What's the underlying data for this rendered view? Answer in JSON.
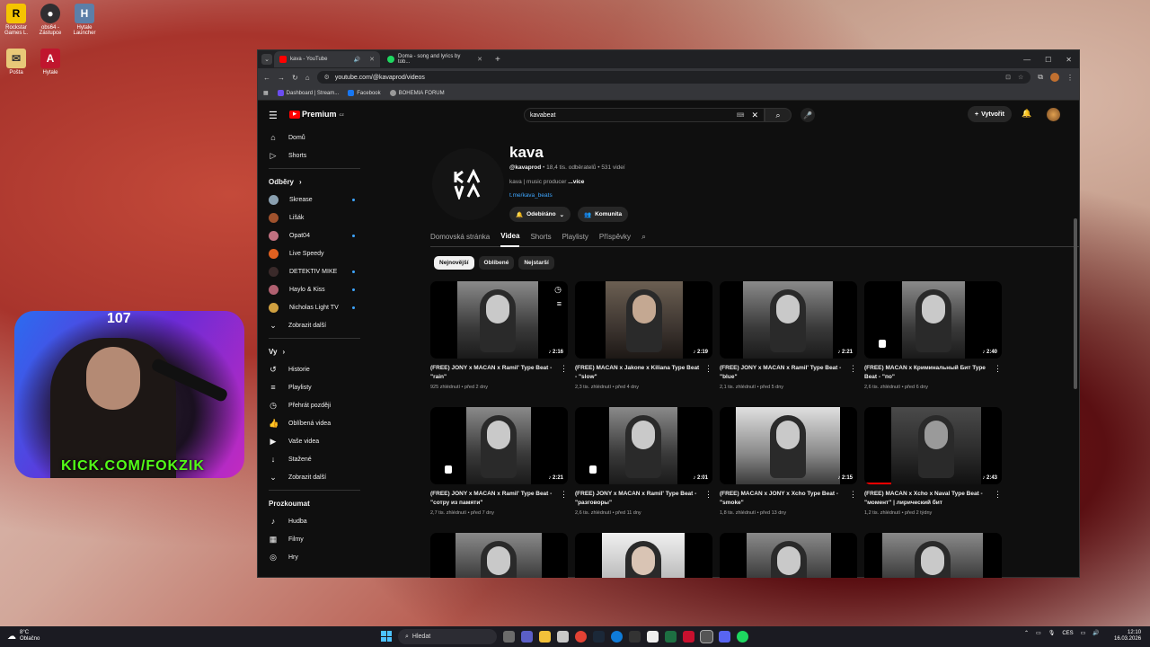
{
  "desktop": {
    "icons": [
      {
        "label": "Rockstar Games L.",
        "glyph": "R",
        "color": "#f5c400",
        "text": "#000"
      },
      {
        "label": "obs64 - Zástupce",
        "glyph": "●",
        "color": "#302e31",
        "text": "#fff"
      },
      {
        "label": "Hytale Launcher",
        "glyph": "H",
        "color": "#5c7fa8",
        "text": "#fff"
      },
      {
        "label": "Pošta",
        "glyph": "✉",
        "color": "#e8c878",
        "text": "#333"
      },
      {
        "label": "Hytale",
        "glyph": "A",
        "color": "#c0162e",
        "text": "#fff"
      }
    ]
  },
  "webcam": {
    "counter": "107",
    "overlay": "KICK.COM/FOKZIK"
  },
  "browser": {
    "tabs": [
      {
        "title": "kava - YouTube",
        "fav_color": "#ff0000",
        "active": true
      },
      {
        "title": "Doma - song and lyrics by tob...",
        "fav_color": "#1ed760",
        "active": false
      }
    ],
    "url": "youtube.com/@kavaprod/videos",
    "bookmarks": [
      {
        "label": "Dashboard | Stream...",
        "color": "#6b4df0"
      },
      {
        "label": "Facebook",
        "color": "#1877f2"
      },
      {
        "label": "BOHEMIA FORUM",
        "color": "#999999"
      }
    ]
  },
  "youtube": {
    "logo_text": "Premium",
    "logo_region": "CZ",
    "search_value": "kavabeat",
    "create_label": "Vytvořit",
    "sidebar": {
      "main": [
        {
          "label": "Domů",
          "icon": "⌂"
        },
        {
          "label": "Shorts",
          "icon": "▷"
        }
      ],
      "subs_heading": "Odběry",
      "subs": [
        {
          "label": "Skrease",
          "color": "#8aa0b0",
          "dot": true
        },
        {
          "label": "Lišák",
          "color": "#a0522d",
          "dot": false
        },
        {
          "label": "Opat04",
          "color": "#c07080",
          "dot": true
        },
        {
          "label": "Live Speedy",
          "color": "#e06020",
          "dot": false
        },
        {
          "label": "DETEKTIV MIKE",
          "color": "#3a2a2a",
          "dot": true
        },
        {
          "label": "Haylo & Kiss",
          "color": "#b06070",
          "dot": true
        },
        {
          "label": "Nicholas Light TV",
          "color": "#d0a040",
          "dot": true
        }
      ],
      "subs_more": "Zobrazit další",
      "you_heading": "Vy",
      "you": [
        {
          "label": "Historie",
          "icon": "↺"
        },
        {
          "label": "Playlisty",
          "icon": "≡"
        },
        {
          "label": "Přehrát později",
          "icon": "◷"
        },
        {
          "label": "Oblíbená videa",
          "icon": "👍"
        },
        {
          "label": "Vaše videa",
          "icon": "▶"
        },
        {
          "label": "Stažené",
          "icon": "↓"
        }
      ],
      "you_more": "Zobrazit další",
      "explore_heading": "Prozkoumat",
      "explore": [
        {
          "label": "Hudba",
          "icon": "♪"
        },
        {
          "label": "Filmy",
          "icon": "▦"
        },
        {
          "label": "Hry",
          "icon": "◎"
        }
      ]
    },
    "channel": {
      "name": "kava",
      "handle": "@kavaprod",
      "stats": " • 18,4 tis. odběratelů • 531 videí",
      "description": "kava | music producer ",
      "more": "...více",
      "link": "t.me/kava_beats",
      "subscribed_label": "Odebíráno",
      "community_label": "Komunita",
      "tabs": [
        "Domovská stránka",
        "Videa",
        "Shorts",
        "Playlisty",
        "Příspěvky"
      ],
      "active_tab": 1,
      "chips": [
        "Nejnovější",
        "Oblíbené",
        "Nejstarší"
      ],
      "active_chip": 0
    },
    "videos": [
      {
        "title": "(FREE) JONY x MACAN x Ramil' Type Beat - \"rain\"",
        "meta": "925 zhlédnutí • před 2 dny",
        "duration": "♪ 2:16"
      },
      {
        "title": "(FREE) MACAN x Jakone x Kiliana Type Beat - \"slow\"",
        "meta": "2,3 tis. zhlédnutí • před 4 dny",
        "duration": "♪ 2:19"
      },
      {
        "title": "(FREE) JONY x MACAN x Ramil' Type Beat - \"blue\"",
        "meta": "2,1 tis. zhlédnutí • před 5 dny",
        "duration": "♪ 2:21"
      },
      {
        "title": "(FREE) MACAN x Криминальный Бит Type Beat - \"по\"",
        "meta": "2,6 tis. zhlédnutí • před 6 dny",
        "duration": "♪ 2:40"
      },
      {
        "title": "(FREE) JONY x MACAN x Ramil' Type Beat - \"сотру из памяти\"",
        "meta": "2,7 tis. zhlédnutí • před 7 dny",
        "duration": "♪ 2:21"
      },
      {
        "title": "(FREE) JONY x MACAN x Ramil' Type Beat - \"разговоры\"",
        "meta": "2,6 tis. zhlédnutí • před 11 dny",
        "duration": "♪ 2:01"
      },
      {
        "title": "(FREE) MACAN x JONY x Xcho Type Beat - \"smoke\"",
        "meta": "1,8 tis. zhlédnutí • před 13 dny",
        "duration": "♪ 2:15"
      },
      {
        "title": "(FREE) MACAN x Xcho x Naval Type Beat - \"момент\" | лирический бит",
        "meta": "1,2 tis. zhlédnutí • před 2 týdny",
        "duration": "♪ 2:43"
      },
      {
        "title": "",
        "meta": "",
        "duration": ""
      },
      {
        "title": "",
        "meta": "",
        "duration": ""
      },
      {
        "title": "",
        "meta": "",
        "duration": ""
      },
      {
        "title": "",
        "meta": "",
        "duration": ""
      }
    ]
  },
  "taskbar": {
    "weather_temp": "8°C",
    "weather_desc": "Oblačno",
    "search_placeholder": "Hledat",
    "lang": "CES",
    "time": "12:10",
    "date": "16.03.2026"
  }
}
